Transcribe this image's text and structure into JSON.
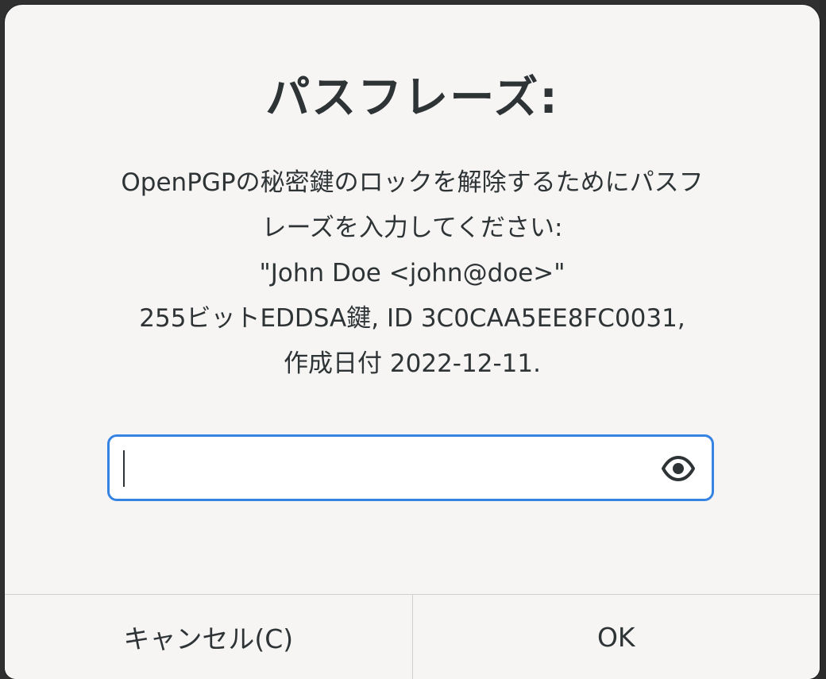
{
  "dialog": {
    "title": "パスフレーズ:",
    "message_lines": [
      "OpenPGPの秘密鍵のロックを解除するためにパスフ",
      "レーズを入力してください:",
      "\"John Doe <john@doe>\"",
      "255ビットEDDSA鍵, ID 3C0CAA5EE8FC0031,",
      "作成日付 2022-12-11."
    ],
    "passphrase_value": "",
    "reveal_icon": "eye-icon",
    "cancel_label": "キャンセル(C)",
    "ok_label": "OK"
  },
  "colors": {
    "dialog_bg": "#f6f5f4",
    "text": "#2e3436",
    "focus_border": "#3584e4",
    "separator": "#d0cfcc"
  }
}
